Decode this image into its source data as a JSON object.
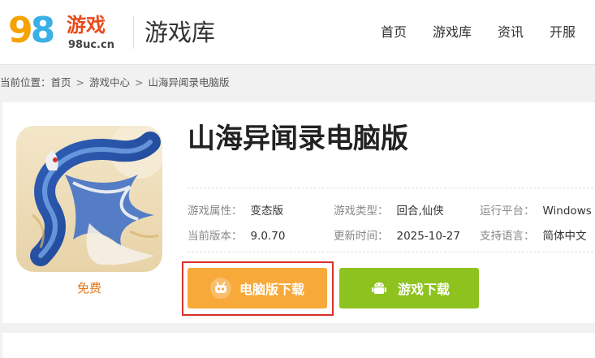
{
  "header": {
    "logo": {
      "digits_9": "9",
      "digits_8": "8",
      "cn": "游戏",
      "domain": "98uc.cn"
    },
    "section_title": "游戏库",
    "nav": [
      "首页",
      "游戏库",
      "资讯",
      "开服"
    ]
  },
  "breadcrumb": {
    "prefix": "当前位置：",
    "items": [
      "首页",
      "游戏中心",
      "山海异闻录电脑版"
    ],
    "separator": ">"
  },
  "game": {
    "title": "山海异闻录电脑版",
    "price": "免费",
    "info": [
      [
        {
          "key": "游戏属性：",
          "value": "变态版"
        },
        {
          "key": "游戏类型：",
          "value": "回合,仙侠"
        },
        {
          "key": "运行平台：",
          "value": "Windows"
        }
      ],
      [
        {
          "key": "当前版本：",
          "value": "9.0.70"
        },
        {
          "key": "更新时间：",
          "value": "2025-10-27"
        },
        {
          "key": "支持语言：",
          "value": "简体中文"
        }
      ]
    ]
  },
  "buttons": {
    "pc_download": "电脑版下载",
    "game_download": "游戏下载"
  },
  "colors": {
    "pc_button": "#f7a93a",
    "game_button": "#8dc21f",
    "price": "#e6761b",
    "highlight_outline": "#d9302a"
  },
  "icons": {
    "pc_button": "gamepad-robot-icon",
    "game_button": "android-icon"
  }
}
